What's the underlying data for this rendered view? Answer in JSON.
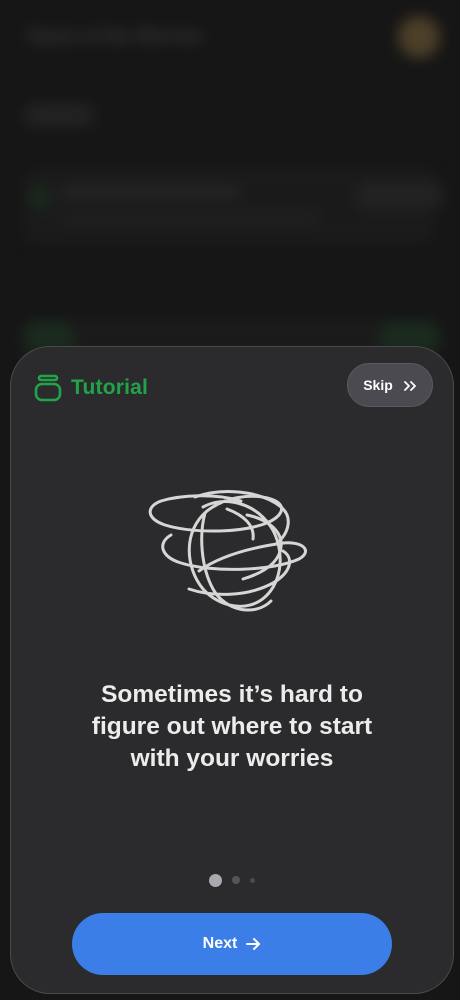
{
  "background_app": {
    "title": "Name of the Worries"
  },
  "tutorial": {
    "title": "Tutorial",
    "brand_icon": "jar-icon",
    "brand_color": "#22a34a",
    "skip_label": "Skip",
    "skip_icon": "double-chevron-right-icon",
    "illustration": "scribble-icon",
    "headline": "Sometimes it’s hard to\nfigure out where to start\nwith your worries",
    "pagination": {
      "current": 1,
      "total": 3
    },
    "next_label": "Next",
    "next_icon": "arrow-right-icon",
    "accent_color": "#3b7ee8"
  }
}
